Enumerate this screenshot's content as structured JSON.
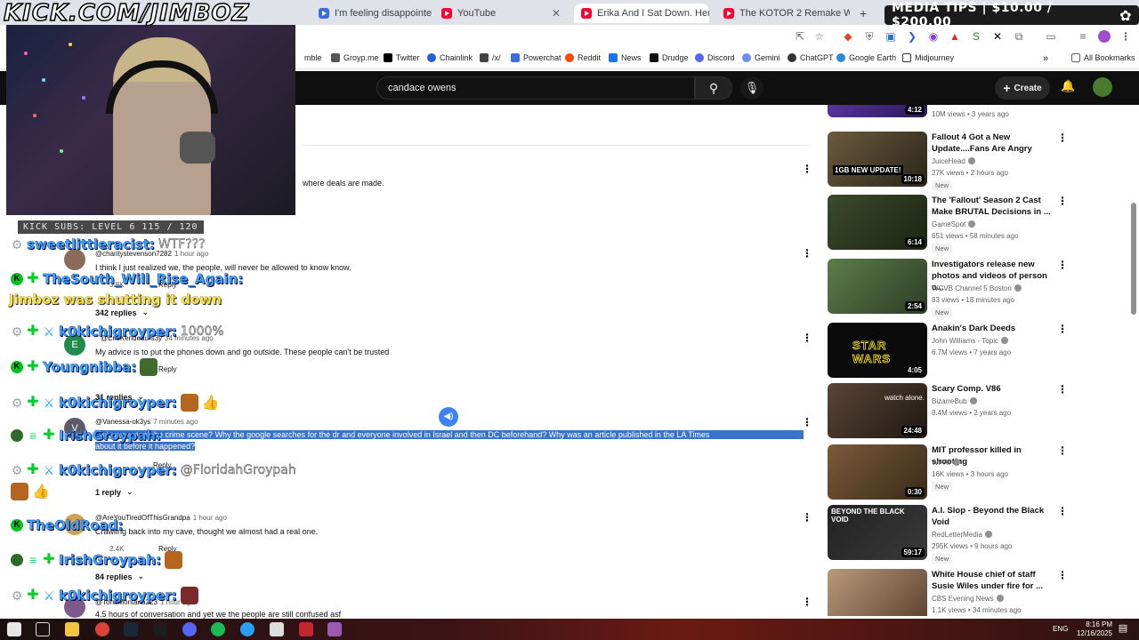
{
  "browser": {
    "tabs": [
      {
        "title": "I'm feeling disappointed to",
        "active": false
      },
      {
        "title": "YouTube",
        "active": false
      },
      {
        "title": "Erika And I Sat Down. Here's W",
        "active": true
      },
      {
        "title": "The KOTOR 2 Remake Was Quie",
        "active": false
      }
    ],
    "new_tab": "+",
    "bookmarks": [
      "mble",
      "Groyp.me",
      "Twitter",
      "Chainlink",
      "/x/",
      "Powerchat",
      "Reddit",
      "News",
      "Drudge",
      "Discord",
      "Gemini",
      "ChatGPT",
      "Google Earth",
      "Midjourney"
    ],
    "all_bookmarks": "All Bookmarks"
  },
  "overlay": {
    "watermark": "KICK.COM/JIMBOZ",
    "media_tips": "MEDIA TIPS | $10.00 / $200.00",
    "kick_subs": "KICK SUBS: LEVEL 6 115 / 120",
    "chat": [
      {
        "name": "sweetlittleracist:",
        "msg": "WTF???",
        "color": "blue"
      },
      {
        "name": "TheSouth_Will_Rise_Again:",
        "msg": "",
        "color": "blue"
      },
      {
        "name": "Jimboz was shutting it down",
        "msg": "",
        "color": "yellow"
      },
      {
        "name": "k0kichigroyper:",
        "msg": "1000%",
        "color": "blue"
      },
      {
        "name": "Youngnibba:",
        "msg": "",
        "color": "blue"
      },
      {
        "name": "k0kichigroyper:",
        "msg": "",
        "color": "blue"
      },
      {
        "name": "IrishGroypah:",
        "msg": "",
        "color": "blue"
      },
      {
        "name": "k0kichigroyper:",
        "msg": "@FloridahGroypah",
        "color": "blue"
      },
      {
        "name": "TheOldRoad:",
        "msg": "",
        "color": "blue"
      },
      {
        "name": "IrishGroypah:",
        "msg": "",
        "color": "blue"
      },
      {
        "name": "k0kichigroyper:",
        "msg": "",
        "color": "blue"
      }
    ]
  },
  "youtube": {
    "search_value": "candace owens",
    "create_label": "Create",
    "comments": [
      {
        "text": "where deals are made.",
        "handle": "",
        "time": ""
      },
      {
        "handle": "@charitystevenson7282",
        "time": "1 hour ago",
        "text": "I think I just realized we, the people, will never be allowed to know know.",
        "likes": "3.8K",
        "reply": "Reply",
        "replies": "342 replies"
      },
      {
        "handle": "@EricKendeau-s3y",
        "time": "34 minutes ago",
        "text": "My advice is to put the phones down and go outside. These people can't be trusted",
        "reply": "Reply",
        "replies": "31 replies"
      },
      {
        "handle": "@Vanessa-ok3ys",
        "time": "7 minutes ago",
        "text_a": "...ely pave over the crime scene? Why the google searches for the dr and everyone involved in Israel and then DC beforehand? Why was an article published in the LA Times",
        "text_b": "about it before it happened?",
        "reply": "Reply",
        "replies": "1 reply"
      },
      {
        "handle": "@AreYouTiredOfThisGrandpa",
        "time": "1 hour ago",
        "text": "Crawling back into my cave, thought we almost had a real one.",
        "likes": "2.4K",
        "reply": "Reply",
        "replies": "84 replies"
      },
      {
        "handle": "@TonaMontana223",
        "time": "1 hour ago",
        "text": "4.5 hours of conversation and yet we the people are still confused asf"
      }
    ]
  },
  "sidebar": [
    {
      "title": "",
      "channel": "",
      "meta": "10M views • 3 years ago",
      "duration": "4:12",
      "new": false
    },
    {
      "title": "Fallout 4 Got a New Update....Fans Are Angry",
      "channel": "JuiceHead",
      "meta": "27K views • 2 hours ago",
      "duration": "10:18",
      "new": true,
      "new_label": "New",
      "thumb_text": "1GB NEW UPDATE!"
    },
    {
      "title": "The 'Fallout' Season 2 Cast Make BRUTAL Decisions in ...",
      "channel": "GameSpot",
      "meta": "651 views • 58 minutes ago",
      "duration": "6:14",
      "new": true,
      "new_label": "New"
    },
    {
      "title": "Investigators release new photos and videos of person o...",
      "channel": "WCVB Channel 5 Boston",
      "meta": "83 views • 18 minutes ago",
      "duration": "2:54",
      "new": true,
      "new_label": "New"
    },
    {
      "title": "Anakin's Dark Deeds",
      "channel": "John Williams - Topic",
      "meta": "6.7M views • 7 years ago",
      "duration": "4:05",
      "new": false,
      "thumb_text": "STAR WARS"
    },
    {
      "title": "Scary Comp. V86",
      "channel": "BizarreBub",
      "meta": "8.4M views • 2 years ago",
      "duration": "24:48",
      "new": false,
      "thumb_text": "watch alone."
    },
    {
      "title": "MIT professor killed in shooting",
      "channel": "WPRI",
      "meta": "16K views • 3 hours ago",
      "duration": "0:30",
      "new": true,
      "new_label": "New"
    },
    {
      "title": "A.I. Slop - Beyond the Black Void",
      "channel": "RedLetterMedia",
      "meta": "295K views • 9 hours ago",
      "duration": "59:17",
      "new": true,
      "new_label": "New",
      "thumb_text": "BEYOND THE BLACK VOID"
    },
    {
      "title": "White House chief of staff Susie Wiles under fire for ...",
      "channel": "CBS Evening News",
      "meta": "1.1K views • 34 minutes ago",
      "duration": "",
      "new": false
    }
  ],
  "taskbar": {
    "lang": "ENG",
    "time": "8:16 PM",
    "date": "12/16/2025"
  },
  "colors": {
    "yt_header": "#0f0f0f",
    "highlight": "#3b73c9",
    "chat_blue": "#3fa9ff",
    "chat_yellow": "#ffe94a"
  }
}
